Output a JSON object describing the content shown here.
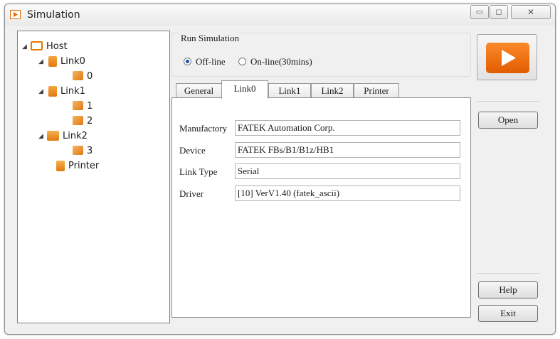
{
  "window": {
    "title": "Simulation"
  },
  "titlebar": {
    "minimize": "▭",
    "maximize": "◻",
    "close": "✕"
  },
  "tree": [
    {
      "label": "Host",
      "icon": "host-icon",
      "expanded": true
    },
    {
      "label": "Link0",
      "icon": "link-icon",
      "expanded": true
    },
    {
      "label": "0",
      "icon": "station-icon"
    },
    {
      "label": "Link1",
      "icon": "link-icon",
      "expanded": true
    },
    {
      "label": "1",
      "icon": "station-icon"
    },
    {
      "label": "2",
      "icon": "station-icon"
    },
    {
      "label": "Link2",
      "icon": "network-icon",
      "expanded": true
    },
    {
      "label": "3",
      "icon": "station-icon"
    },
    {
      "label": "Printer",
      "icon": "printer-icon"
    }
  ],
  "run_simulation": {
    "title": "Run Simulation",
    "offline_label": "Off-line",
    "online_label": "On-line(30mins)",
    "selected": "Off-line"
  },
  "tabs": [
    "General",
    "Link0",
    "Link1",
    "Link2",
    "Printer"
  ],
  "active_tab": "Link0",
  "fields": [
    {
      "label": "Manufactory",
      "value": "FATEK Automation Corp."
    },
    {
      "label": "Device",
      "value": "FATEK FBs/B1/B1z/HB1"
    },
    {
      "label": "Link Type",
      "value": "Serial"
    },
    {
      "label": "Driver",
      "value": "[10] VerV1.40 (fatek_ascii)"
    }
  ],
  "buttons": {
    "open": "Open",
    "help": "Help",
    "exit": "Exit"
  },
  "colors": {
    "accent": "#F07A10",
    "run_button": "#EE6A00"
  }
}
